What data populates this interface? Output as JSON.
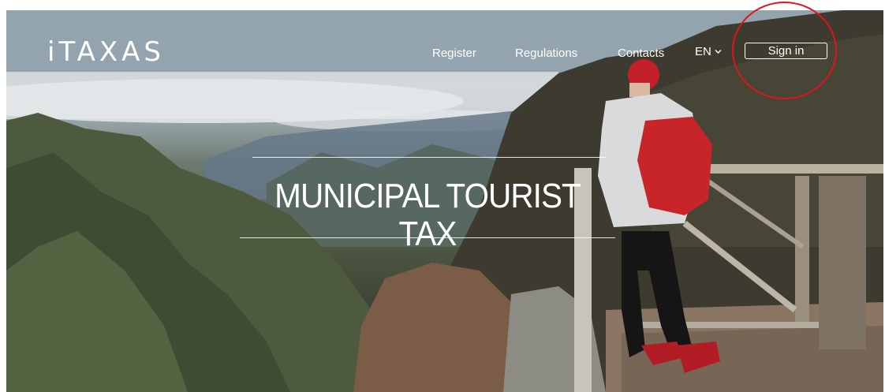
{
  "brand": {
    "logo_text": "iTAXAS"
  },
  "nav": {
    "register": "Register",
    "regulations": "Regulations",
    "contacts": "Contacts",
    "language": "EN",
    "sign_in": "Sign in"
  },
  "hero": {
    "headline": "MUNICIPAL TOURIST TAX"
  },
  "icons": {
    "language_dropdown": "chevron-down-icon"
  },
  "colors": {
    "highlight": "#e0141e",
    "nav_text": "#ffffff"
  }
}
